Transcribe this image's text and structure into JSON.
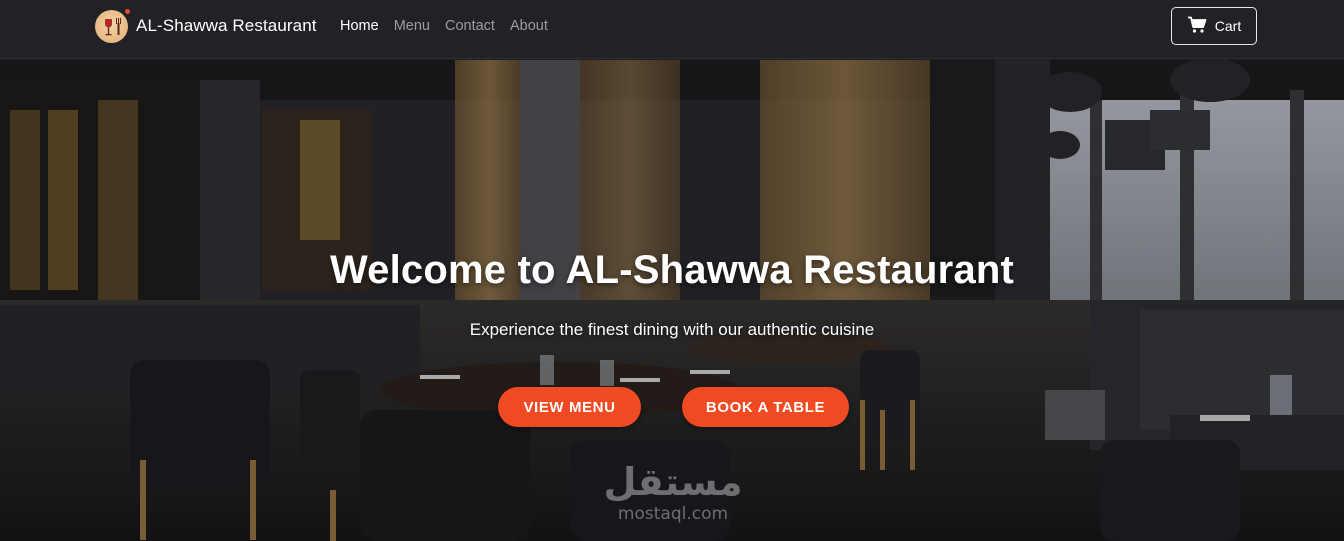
{
  "brand": {
    "name": "AL-Shawwa Restaurant",
    "logo_icon": "wine-glass-fork-icon"
  },
  "nav": {
    "items": [
      {
        "label": "Home",
        "active": true
      },
      {
        "label": "Menu",
        "active": false
      },
      {
        "label": "Contact",
        "active": false
      },
      {
        "label": "About",
        "active": false
      }
    ]
  },
  "cart": {
    "label": "Cart",
    "icon": "cart-icon"
  },
  "hero": {
    "title": "Welcome to AL-Shawwa Restaurant",
    "subtitle": "Experience the finest dining with our authentic cuisine",
    "primary_button": "VIEW MENU",
    "secondary_button": "BOOK A TABLE"
  },
  "watermark": {
    "arabic": "مستقل",
    "latin": "mostaql.com"
  },
  "colors": {
    "navbar_bg": "#212226",
    "accent": "#f04a23",
    "nav_inactive": "#9b9ca1",
    "nav_active": "#ffffff"
  }
}
